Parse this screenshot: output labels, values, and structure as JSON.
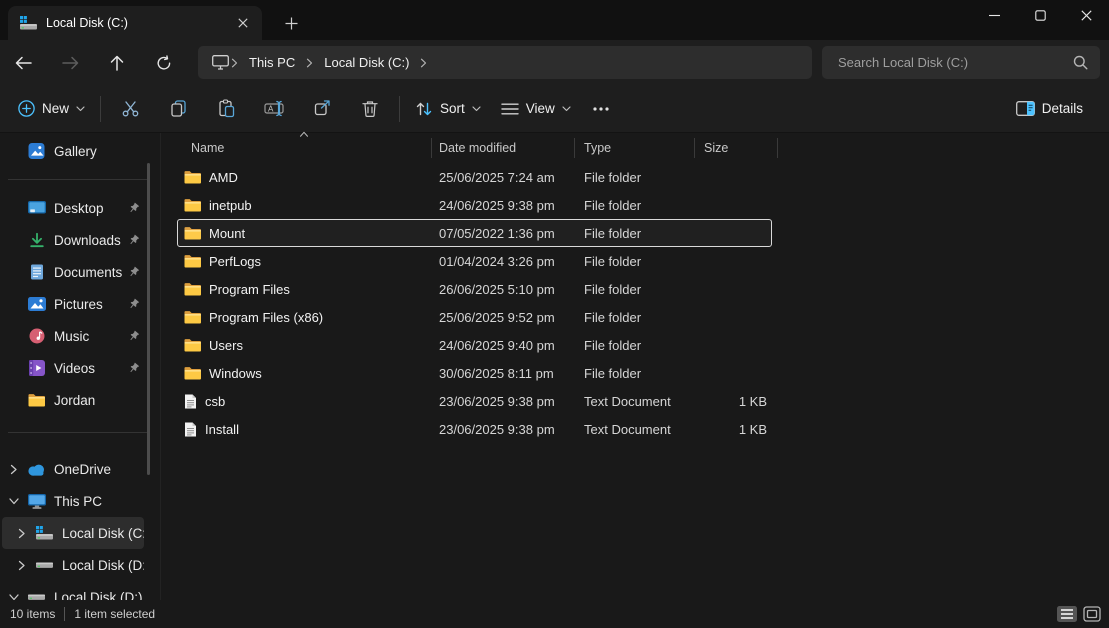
{
  "window": {
    "tab_title": "Local Disk (C:)"
  },
  "nav": {
    "breadcrumb_items": [
      "This PC",
      "Local Disk (C:)"
    ],
    "search_placeholder": "Search Local Disk (C:)"
  },
  "toolbar": {
    "new": "New",
    "sort": "Sort",
    "view": "View",
    "details": "Details"
  },
  "sidebar": {
    "items": [
      {
        "label": "Gallery",
        "icon": "gallery"
      },
      {
        "type": "separator"
      },
      {
        "label": "Desktop",
        "icon": "desktop",
        "pinned": true
      },
      {
        "label": "Downloads",
        "icon": "downloads",
        "pinned": true
      },
      {
        "label": "Documents",
        "icon": "documents",
        "pinned": true
      },
      {
        "label": "Pictures",
        "icon": "pictures",
        "pinned": true
      },
      {
        "label": "Music",
        "icon": "music",
        "pinned": true
      },
      {
        "label": "Videos",
        "icon": "videos",
        "pinned": true
      },
      {
        "label": "Jordan",
        "icon": "folder"
      },
      {
        "type": "separator"
      },
      {
        "label": "OneDrive",
        "icon": "onedrive",
        "chevron": "right"
      },
      {
        "label": "This PC",
        "icon": "thispc",
        "chevron": "down"
      },
      {
        "label": "Local Disk (C:)",
        "icon": "drivewin",
        "chevron": "right",
        "indent": 1,
        "selected": true
      },
      {
        "label": "Local Disk (D:)",
        "icon": "drive",
        "chevron": "right",
        "indent": 1
      },
      {
        "label": "Local Disk (D:)",
        "icon": "drive",
        "chevron": "down"
      }
    ]
  },
  "filelist": {
    "columns": [
      "Name",
      "Date modified",
      "Type",
      "Size"
    ],
    "rows": [
      {
        "name": "AMD",
        "date": "25/06/2025 7:24 am",
        "type": "File folder",
        "size": "",
        "icon": "folder"
      },
      {
        "name": "inetpub",
        "date": "24/06/2025 9:38 pm",
        "type": "File folder",
        "size": "",
        "icon": "folder"
      },
      {
        "name": "Mount",
        "date": "07/05/2022 1:36 pm",
        "type": "File folder",
        "size": "",
        "icon": "folder",
        "selected": true
      },
      {
        "name": "PerfLogs",
        "date": "01/04/2024 3:26 pm",
        "type": "File folder",
        "size": "",
        "icon": "folder"
      },
      {
        "name": "Program Files",
        "date": "26/06/2025 5:10 pm",
        "type": "File folder",
        "size": "",
        "icon": "folder"
      },
      {
        "name": "Program Files (x86)",
        "date": "25/06/2025 9:52 pm",
        "type": "File folder",
        "size": "",
        "icon": "folder"
      },
      {
        "name": "Users",
        "date": "24/06/2025 9:40 pm",
        "type": "File folder",
        "size": "",
        "icon": "folder"
      },
      {
        "name": "Windows",
        "date": "30/06/2025 8:11 pm",
        "type": "File folder",
        "size": "",
        "icon": "folder"
      },
      {
        "name": "csb",
        "date": "23/06/2025 9:38 pm",
        "type": "Text Document",
        "size": "1 KB",
        "icon": "textdoc"
      },
      {
        "name": "Install",
        "date": "23/06/2025 9:38 pm",
        "type": "Text Document",
        "size": "1 KB",
        "icon": "textdoc"
      }
    ]
  },
  "statusbar": {
    "items_count": "10 items",
    "selection": "1 item selected"
  },
  "colors": {
    "accent": "#4cc2ff",
    "folder": "#f6c64b",
    "selection_outline": "#d9d9d9"
  }
}
